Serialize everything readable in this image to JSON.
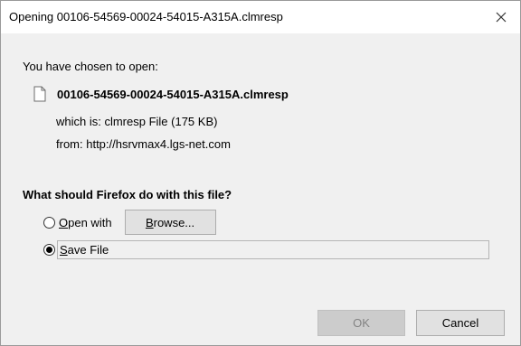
{
  "dialog": {
    "title": "Opening 00106-54569-00024-54015-A315A.clmresp",
    "close_icon": "close-icon"
  },
  "intro": {
    "chosen_label": "You have chosen to open:",
    "file_name": "00106-54569-00024-54015-A315A.clmresp",
    "file_icon": "document-icon",
    "which_is": "which is:  clmresp File (175 KB)",
    "from": "from:  http://hsrvmax4.lgs-net.com"
  },
  "question": "What should Firefox do with this file?",
  "options": {
    "open_with": {
      "accel": "O",
      "rest": "pen with",
      "selected": false
    },
    "browse": {
      "accel": "B",
      "rest": "rowse..."
    },
    "save_file": {
      "accel": "S",
      "rest": "ave File",
      "selected": true
    }
  },
  "buttons": {
    "ok": "OK",
    "cancel": "Cancel",
    "ok_enabled": false
  },
  "colors": {
    "dialog_bg": "#f0f0f0",
    "titlebar_bg": "#ffffff",
    "button_bg": "#e1e1e1",
    "disabled_button_bg": "#cccccc",
    "disabled_text": "#838383"
  }
}
